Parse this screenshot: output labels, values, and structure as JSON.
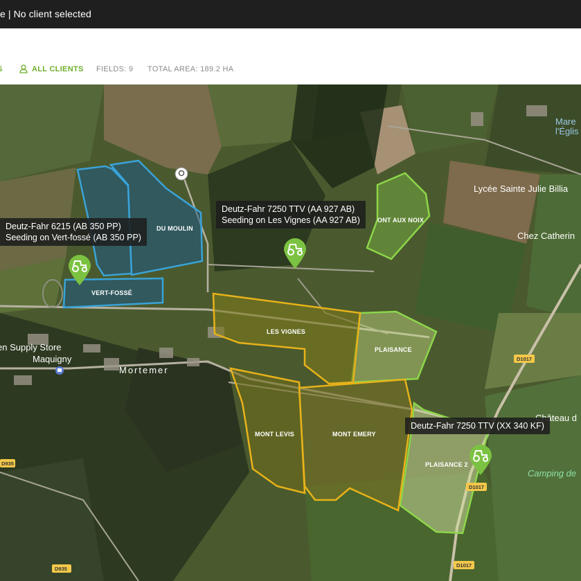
{
  "topbar": {
    "title": "e | No client selected"
  },
  "filters": {
    "first_fragment": "S",
    "clients_label": "ALL CLIENTS",
    "fields_count": "FIELDS: 9",
    "total_area": "TOTAL AREA:  189.2 HA"
  },
  "map": {
    "fields": [
      {
        "name": "VERT-FOSSÉ",
        "group": "blue"
      },
      {
        "name": "DU MOULIN",
        "group": "blue"
      },
      {
        "name": "ONT AUX NOIX",
        "group": "lightgreen"
      },
      {
        "name": "LES VIGNES",
        "group": "yellow"
      },
      {
        "name": "PLAISANCE",
        "group": "lightgreen"
      },
      {
        "name": "MONT LEVIS",
        "group": "yellow"
      },
      {
        "name": "MONT EMERY",
        "group": "yellow"
      },
      {
        "name": "PLAISANCE 2",
        "group": "lightgreen"
      }
    ],
    "places": {
      "lycee": "Lycée Sainte Julie Billia",
      "chez": "Chez Catherin",
      "supply_store": "en Supply Store",
      "maquigny": "Maquigny",
      "mortemer": "Mortemer",
      "chateau": "Château d",
      "camping": "Camping de",
      "mare": "Mare",
      "eglise": "l'Églis"
    },
    "roads": {
      "d1017a": "D1017",
      "d1017b": "D1017",
      "d1017c": "D1017",
      "d935a": "D935",
      "d935b": "D935"
    },
    "tractors": [
      {
        "line1": "Deutz-Fahr 6215 (AB 350 PP)",
        "line2": "Seeding on Vert-fossé (AB 350 PP)"
      },
      {
        "line1": "Deutz-Fahr 7250 TTV (AA 927 AB)",
        "line2": "Seeding on Les Vignes (AA 927 AB)"
      },
      {
        "line1": "Deutz-Fahr 7250 TTV (XX 340 KF)",
        "line2": ""
      }
    ],
    "colors": {
      "blue": "#3aa3d8",
      "yellow": "#e8b21a",
      "lightgreen": "#8cd64a",
      "pin": "#7cc242"
    },
    "icons": {
      "tractor": "tractor-icon",
      "location": "location-pin-icon",
      "user": "user-icon"
    }
  }
}
